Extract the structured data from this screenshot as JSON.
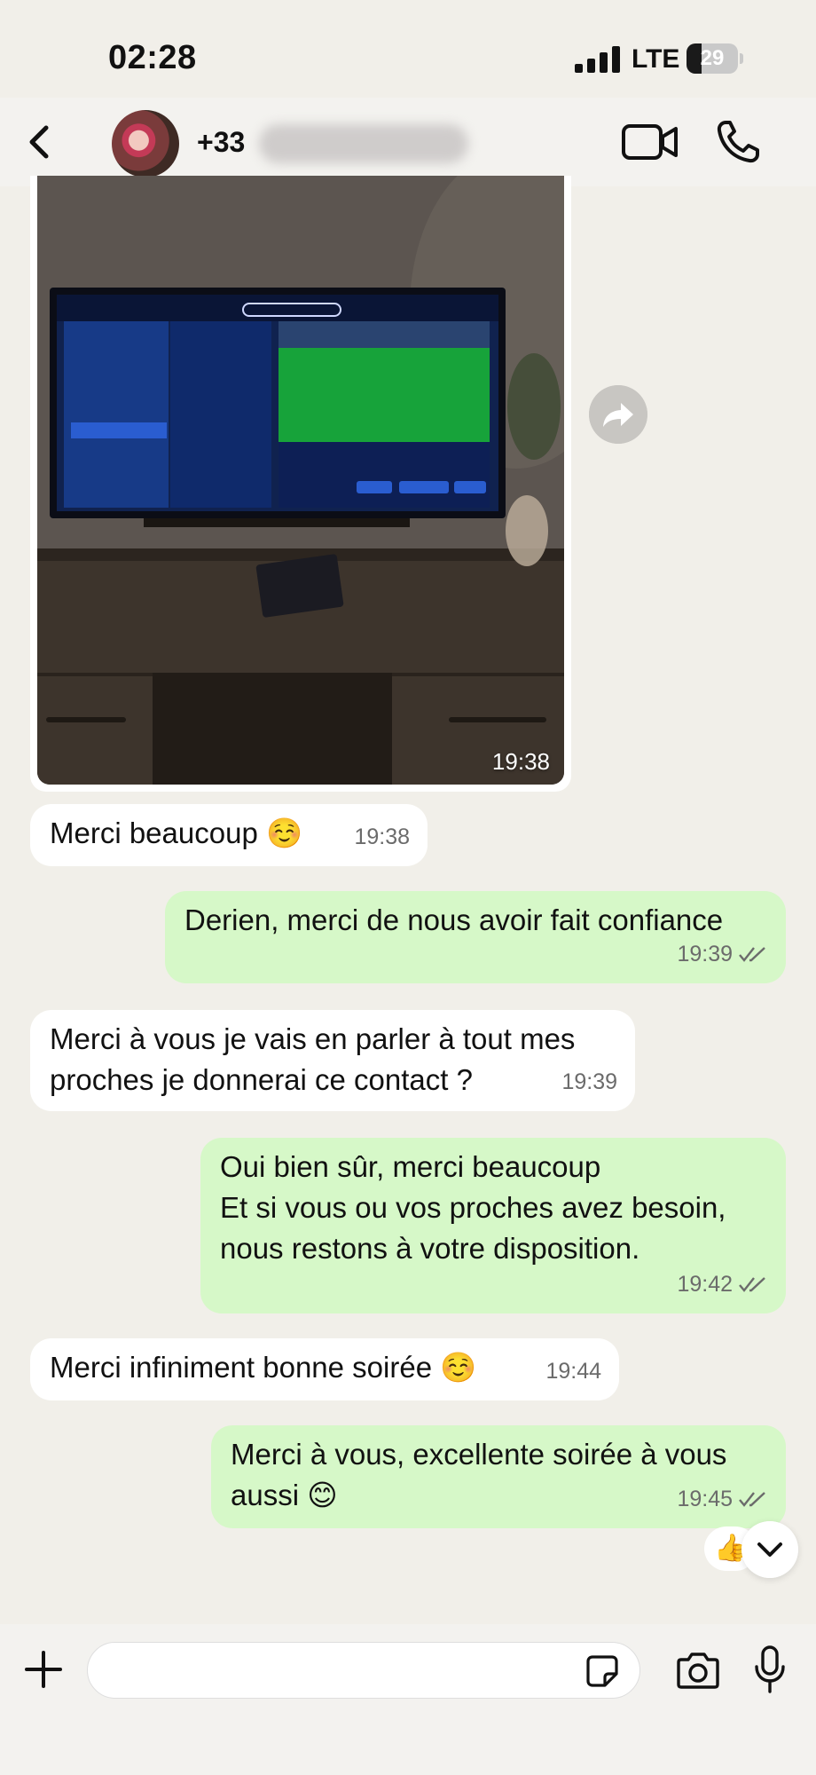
{
  "status_bar": {
    "time": "02:28",
    "network": "LTE",
    "battery": "29",
    "battery_level": 0.29,
    "signal_bars": 4
  },
  "header": {
    "contact_name": "+33",
    "icons": [
      "back-chevron-icon",
      "video-call-icon",
      "phone-icon"
    ]
  },
  "photo_message": {
    "time": "19:38",
    "forward_icon": "forward-arrow-icon"
  },
  "messages": [
    {
      "direction": "in",
      "text": "Merci beaucoup ☺️",
      "time": "19:38"
    },
    {
      "direction": "out",
      "text": "Derien, merci de nous avoir fait confiance",
      "time": "19:39",
      "read": true
    },
    {
      "direction": "in",
      "text": "Merci à vous je vais en parler à tout mes proches je donnerai ce contact ?",
      "time": "19:39"
    },
    {
      "direction": "out",
      "text": "Oui bien sûr, merci beaucoup\nEt si vous ou vos proches avez besoin, nous restons à votre disposition.",
      "time": "19:42",
      "read": true
    },
    {
      "direction": "in",
      "text": "Merci infiniment bonne soirée ☺️",
      "time": "19:44"
    },
    {
      "direction": "out",
      "text": "Merci à vous, excellente soirée à vous aussi 😊",
      "time": "19:45",
      "read": true
    }
  ],
  "reaction": "👍",
  "composer": {
    "placeholder": "",
    "icons": [
      "plus-icon",
      "sticker-icon",
      "camera-icon",
      "microphone-icon"
    ]
  },
  "colors": {
    "background": "#f1efe9",
    "incoming_bubble": "#ffffff",
    "outgoing_bubble": "#d6f8c8",
    "read_ticks": "#6b6b6b"
  }
}
